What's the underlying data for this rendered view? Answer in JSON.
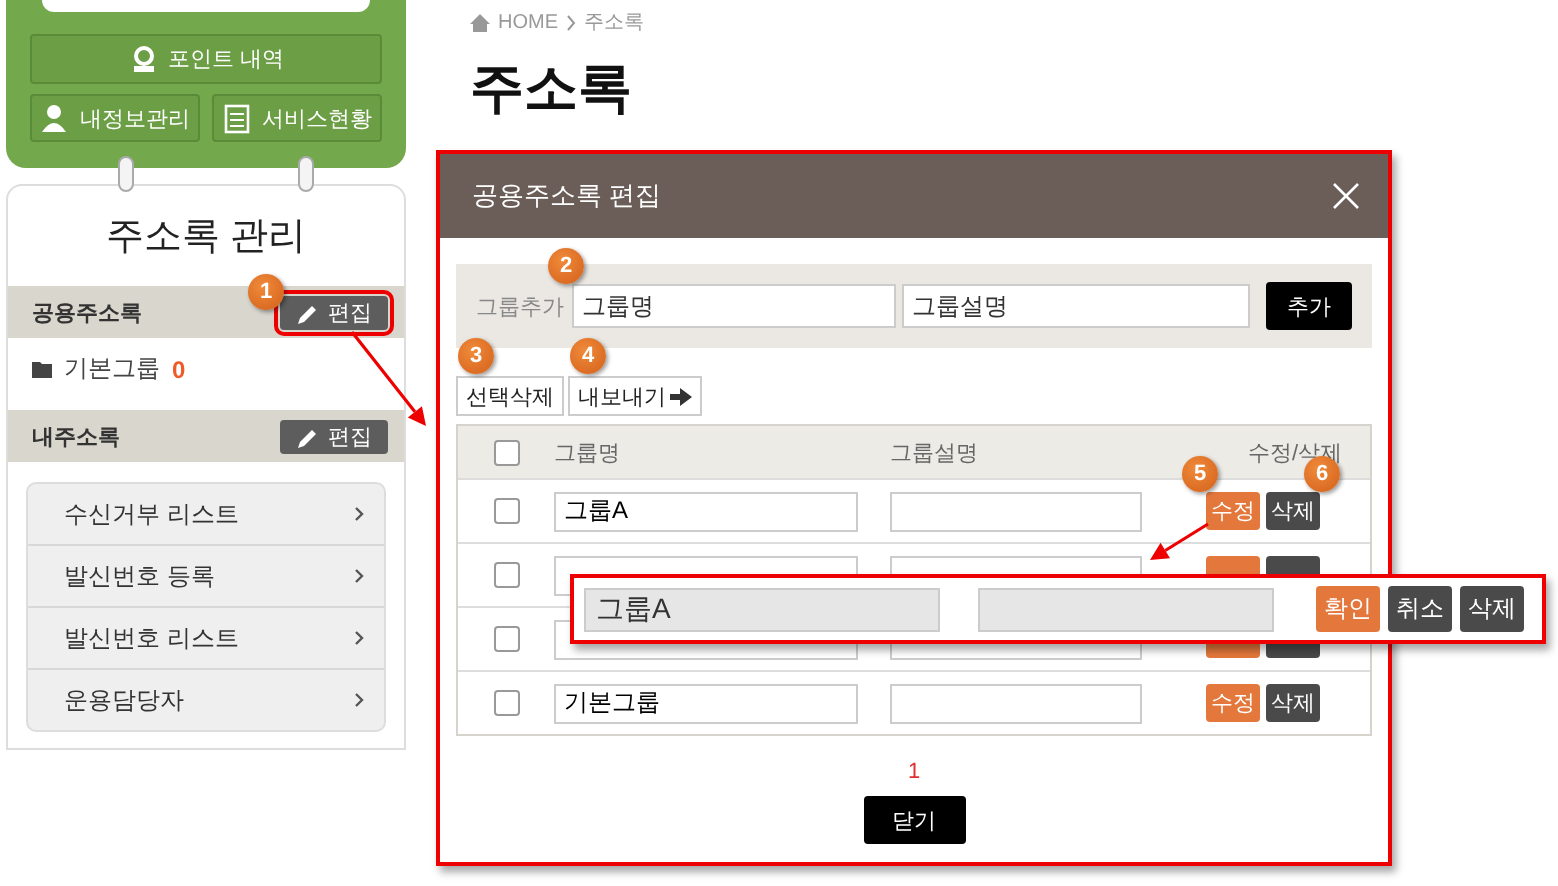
{
  "sidebar": {
    "buttons": [
      {
        "label": "포인트 내역",
        "kind": "points"
      },
      {
        "label": "내정보관리",
        "kind": "profile"
      },
      {
        "label": "서비스현황",
        "kind": "service"
      }
    ],
    "title": "주소록 관리",
    "shared": {
      "title": "공용주소록",
      "edit": "편집",
      "highlighted": true,
      "badge": "1"
    },
    "groups": [
      {
        "name": "기본그룹",
        "count": "0"
      }
    ],
    "mine": {
      "title": "내주소록",
      "edit": "편집",
      "highlighted": false
    },
    "menu": [
      "수신거부 리스트",
      "발신번호 등록",
      "발신번호 리스트",
      "운용담당자"
    ]
  },
  "breadcrumb": {
    "home": "HOME",
    "current": "주소록"
  },
  "page_title": "주소록",
  "dialog": {
    "title": "공용주소록 편집",
    "add": {
      "label": "그룹추가",
      "name_placeholder": "그룹명",
      "desc_placeholder": "그룹설명",
      "button": "추가",
      "badge": "2"
    },
    "toolbar": [
      {
        "label": "선택삭제",
        "kind": "delete",
        "badge": "3"
      },
      {
        "label": "내보내기",
        "kind": "export",
        "badge": "4"
      }
    ],
    "all_checked": false,
    "columns": [
      "그룹명",
      "그룹설명",
      "수정/삭제"
    ],
    "rows": [
      {
        "checked": false,
        "name": "그룹A",
        "edit": "수정",
        "delete": "삭제",
        "edit_badge": "5",
        "delete_badge": "6"
      },
      {
        "checked": false
      },
      {
        "checked": false
      },
      {
        "checked": false,
        "name": "기본그룹",
        "edit": "수정",
        "delete": "삭제"
      }
    ],
    "pages": [
      {
        "label": "1",
        "selected": true
      }
    ],
    "close": "닫기"
  },
  "edit_popup": {
    "name": "그룹A",
    "buttons": [
      {
        "label": "확인",
        "kind": "confirm"
      },
      {
        "label": "취소",
        "kind": "cancel"
      },
      {
        "label": "삭제",
        "kind": "delete"
      }
    ]
  }
}
